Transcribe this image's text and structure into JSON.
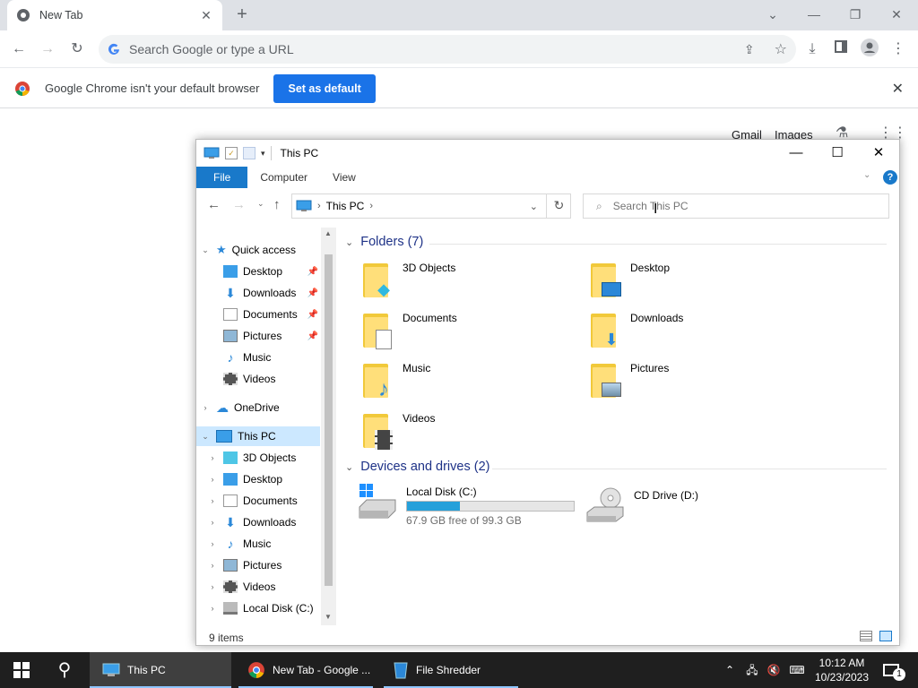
{
  "chrome": {
    "tab_title": "New Tab",
    "tab_close": "✕",
    "new_tab": "+",
    "window_controls": {
      "tabsearch": "⌄",
      "minimize": "—",
      "restore": "❐",
      "close": "✕"
    },
    "omnibox_placeholder": "Search Google or type a URL",
    "infobar": {
      "message": "Google Chrome isn't your default browser",
      "button": "Set as default",
      "close": "✕"
    },
    "page_links": {
      "gmail": "Gmail",
      "images": "Images"
    }
  },
  "explorer": {
    "title": "This PC",
    "ribbon_tabs": [
      "File",
      "Computer",
      "View"
    ],
    "address": "This PC",
    "search_placeholder": "Search This PC",
    "nav": {
      "quick_access": "Quick access",
      "quick_items": [
        "Desktop",
        "Downloads",
        "Documents",
        "Pictures",
        "Music",
        "Videos"
      ],
      "onedrive": "OneDrive",
      "this_pc": "This PC",
      "pc_items": [
        "3D Objects",
        "Desktop",
        "Documents",
        "Downloads",
        "Music",
        "Pictures",
        "Videos",
        "Local Disk (C:)"
      ]
    },
    "folders_header": "Folders (7)",
    "folders": [
      "3D Objects",
      "Desktop",
      "Documents",
      "Downloads",
      "Music",
      "Pictures",
      "Videos"
    ],
    "drives_header": "Devices and drives (2)",
    "drives": [
      {
        "name": "Local Disk (C:)",
        "free": "67.9 GB free of 99.3 GB",
        "used_fraction": 0.316
      },
      {
        "name": "CD Drive (D:)"
      }
    ],
    "status": "9 items"
  },
  "taskbar": {
    "items": [
      "This PC",
      "New Tab - Google ...",
      "File Shredder"
    ],
    "time": "10:12 AM",
    "date": "10/23/2023",
    "notification_count": "1"
  },
  "colors": {
    "accent": "#1a73e8",
    "file_tab": "#1979ca",
    "selection": "#cce8ff",
    "taskbar": "#1f1f1f",
    "folder": "#f1c93a"
  }
}
